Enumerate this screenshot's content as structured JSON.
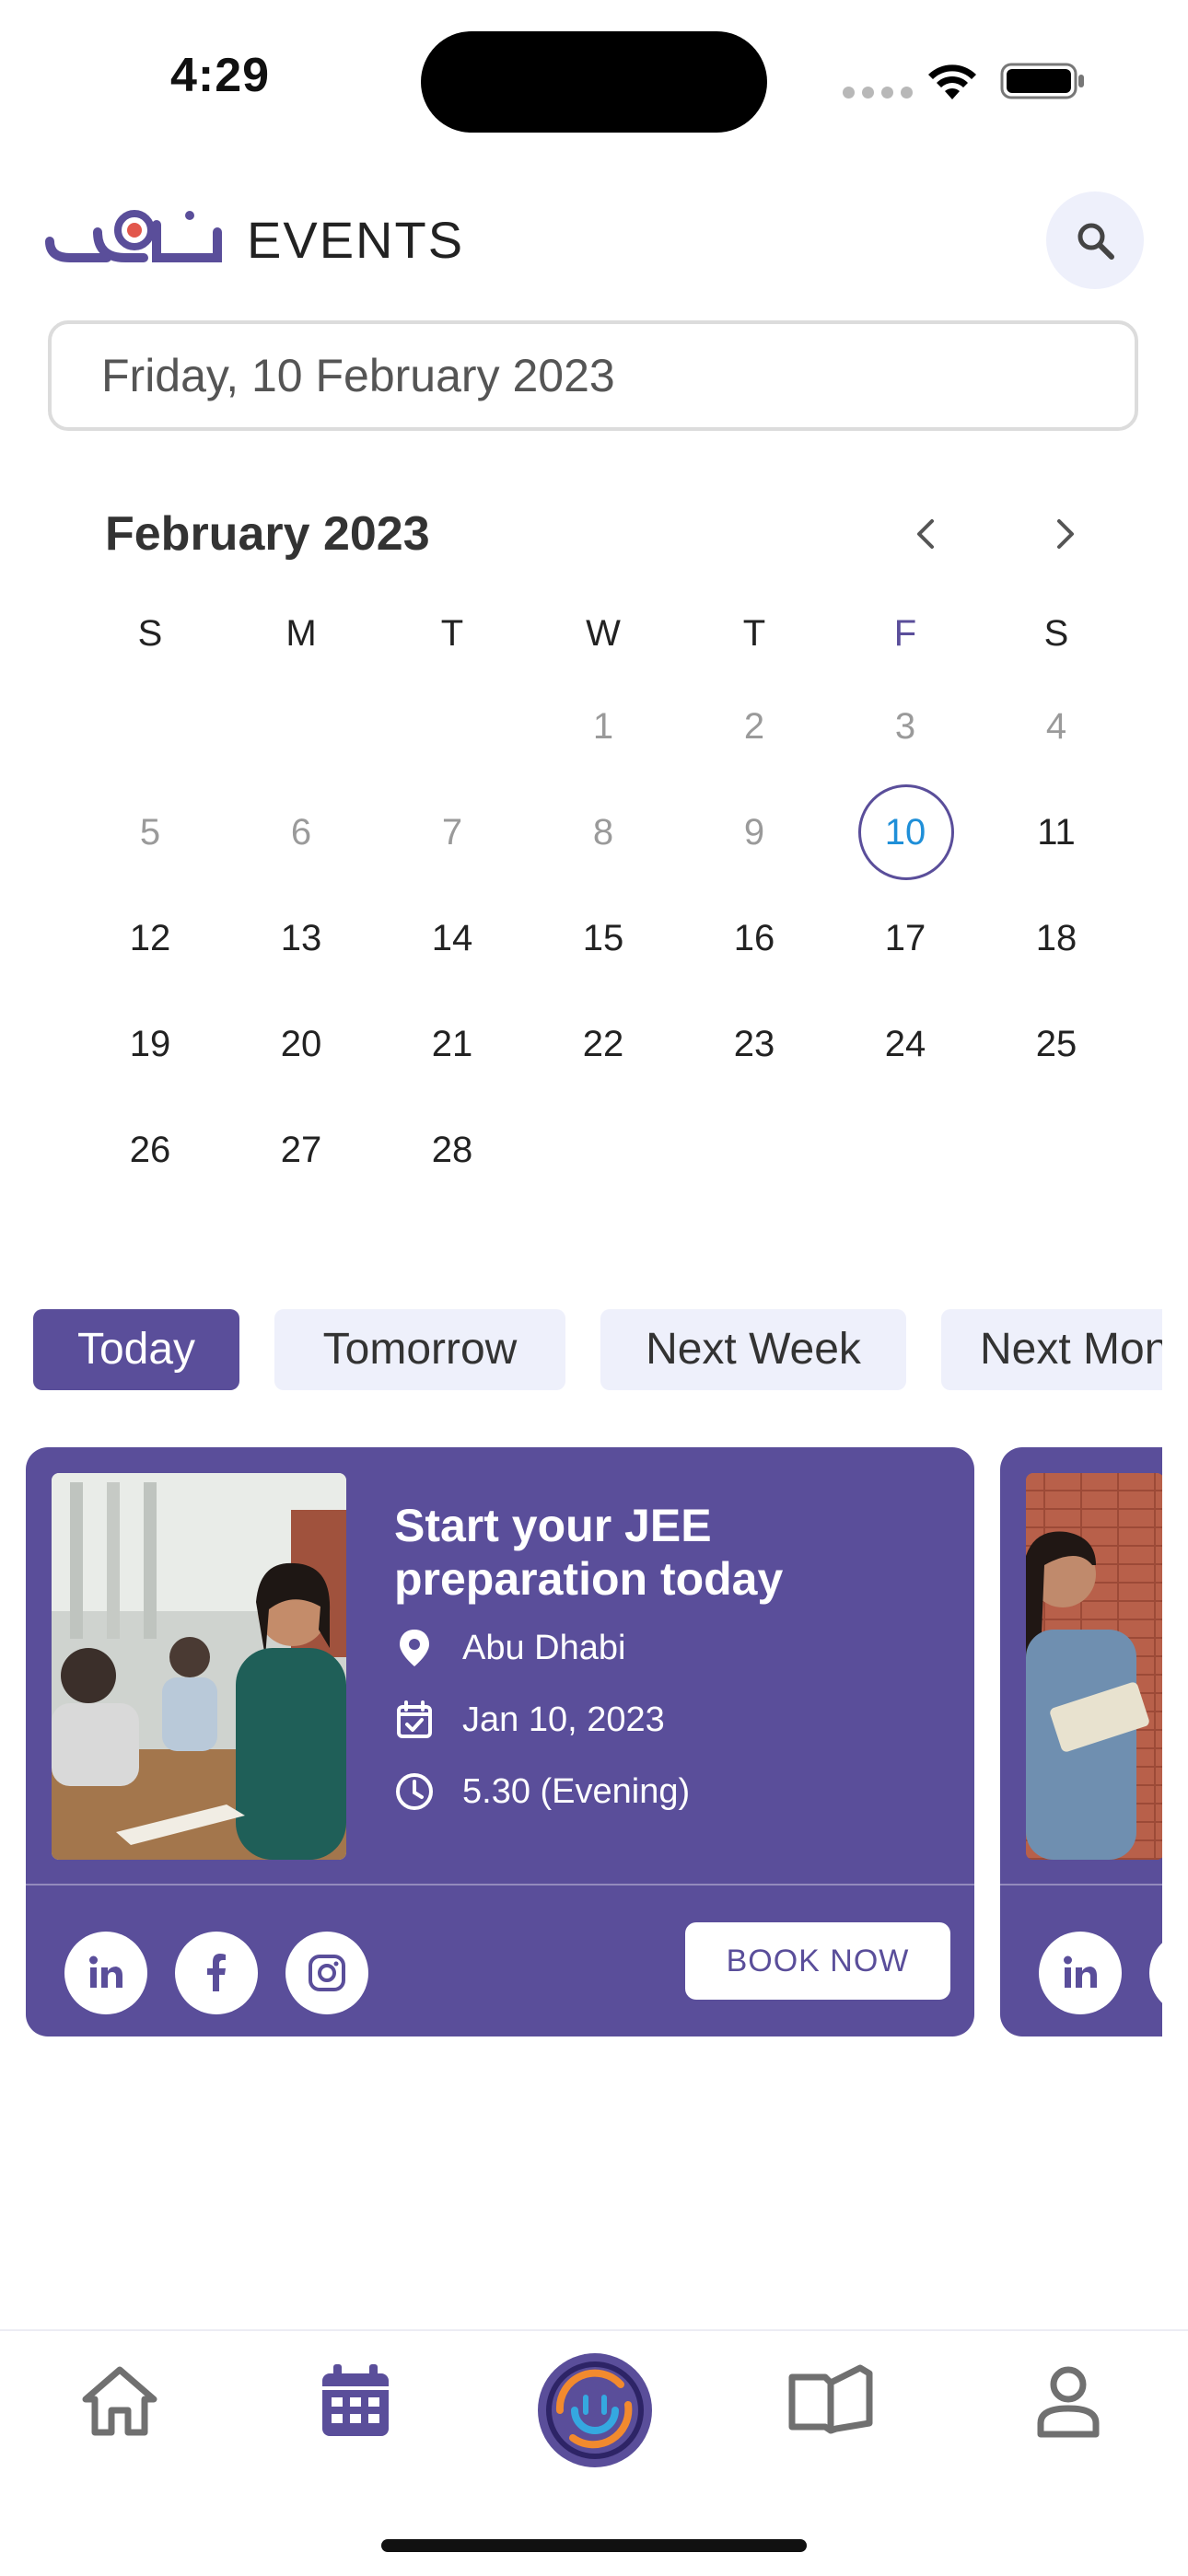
{
  "status_bar": {
    "time": "4:29"
  },
  "header": {
    "logo_text": "دروب",
    "title": "EVENTS"
  },
  "date_field": {
    "value": "Friday, 10 February 2023"
  },
  "calendar": {
    "month_label": "February 2023",
    "weekdays": [
      "S",
      "M",
      "T",
      "W",
      "T",
      "F",
      "S"
    ],
    "weeks": [
      [
        "",
        "",
        "",
        "1",
        "2",
        "3",
        "4"
      ],
      [
        "5",
        "6",
        "7",
        "8",
        "9",
        "10",
        "11"
      ],
      [
        "12",
        "13",
        "14",
        "15",
        "16",
        "17",
        "18"
      ],
      [
        "19",
        "20",
        "21",
        "22",
        "23",
        "24",
        "25"
      ],
      [
        "26",
        "27",
        "28",
        "",
        "",
        "",
        ""
      ]
    ],
    "selected_day": "10"
  },
  "filters": {
    "items": [
      "Today",
      "Tomorrow",
      "Next Week",
      "Next Month"
    ],
    "active": "Today"
  },
  "event_card": {
    "title": "Start your JEE preparation today",
    "location": "Abu Dhabi",
    "date": "Jan 10, 2023",
    "time": "5.30 (Evening)",
    "book_label": "BOOK NOW",
    "social": [
      "linkedin-icon",
      "facebook-icon",
      "instagram-icon"
    ]
  },
  "nav": {
    "items": [
      "home-icon",
      "calendar-icon",
      "app-logo-icon",
      "book-icon",
      "profile-icon"
    ]
  },
  "colors": {
    "brand": "#5a4e9a",
    "chip_bg": "#eef0fb",
    "selected_day_text": "#1f8fd8"
  }
}
